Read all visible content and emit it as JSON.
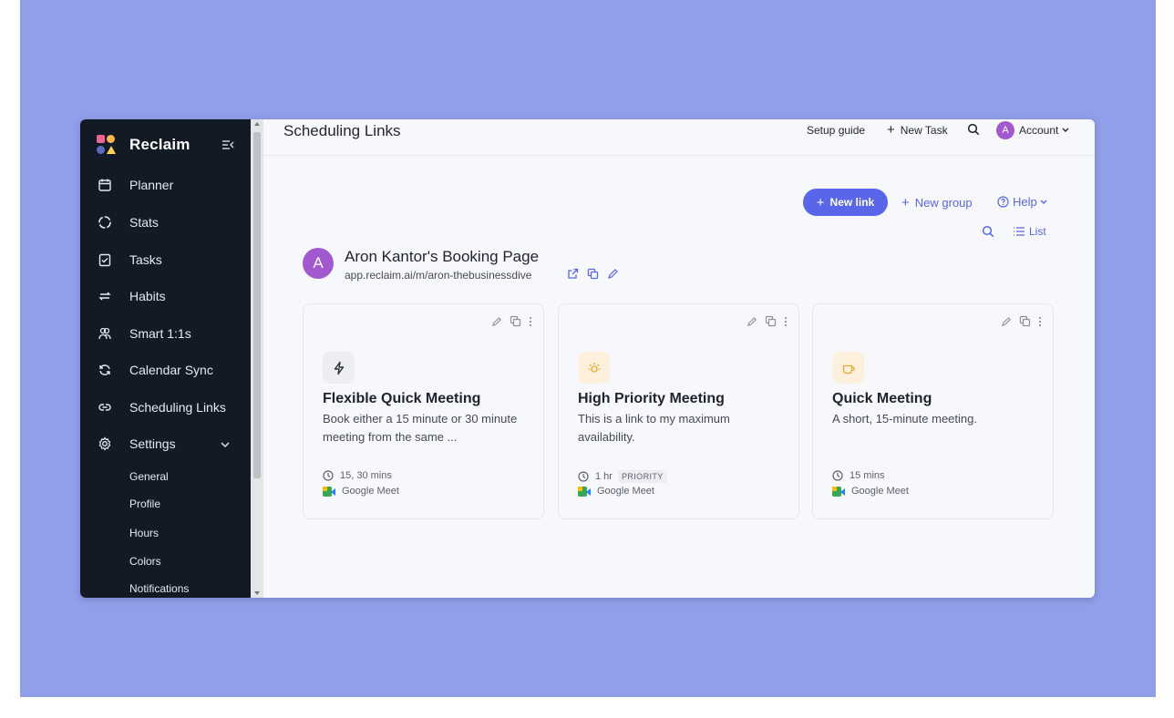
{
  "brand": {
    "name": "Reclaim"
  },
  "sidebar": {
    "items": [
      {
        "label": "Planner",
        "icon": "calendar-icon"
      },
      {
        "label": "Stats",
        "icon": "stats-icon"
      },
      {
        "label": "Tasks",
        "icon": "tasks-icon"
      },
      {
        "label": "Habits",
        "icon": "habits-icon"
      },
      {
        "label": "Smart 1:1s",
        "icon": "people-icon"
      },
      {
        "label": "Calendar Sync",
        "icon": "sync-icon"
      },
      {
        "label": "Scheduling Links",
        "icon": "link-icon"
      },
      {
        "label": "Settings",
        "icon": "gear-icon"
      }
    ],
    "settings_sub": [
      "General",
      "Profile",
      "Hours",
      "Colors",
      "Notifications"
    ]
  },
  "header": {
    "title": "Scheduling Links",
    "setup_guide": "Setup guide",
    "new_task": "New Task",
    "account": "Account",
    "avatar_letter": "A"
  },
  "toolbar": {
    "new_link": "New link",
    "new_group": "New group",
    "help": "Help",
    "list": "List"
  },
  "booking_page": {
    "avatar_letter": "A",
    "title": "Aron Kantor's Booking Page",
    "url": "app.reclaim.ai/m/aron-thebusinessdive"
  },
  "cards": [
    {
      "title": "Flexible Quick Meeting",
      "desc": "Book either a 15 minute or 30 minute meeting from the same ...",
      "duration": "15, 30 mins",
      "badge": "",
      "conference": "Google Meet",
      "icon": "bolt-icon",
      "icon_bg": "#eceef2"
    },
    {
      "title": "High Priority Meeting",
      "desc": "This is a link to my maximum availability.",
      "duration": "1 hr",
      "badge": "PRIORITY",
      "conference": "Google Meet",
      "icon": "sun-icon",
      "icon_bg": "#fdf1dd"
    },
    {
      "title": "Quick Meeting",
      "desc": "A short, 15-minute meeting.",
      "duration": "15 mins",
      "badge": "",
      "conference": "Google Meet",
      "icon": "coffee-icon",
      "icon_bg": "#fdf1dd"
    }
  ],
  "colors": {
    "accent": "#5966ea",
    "sidebar_bg": "#121a26",
    "backdrop": "#919fea",
    "avatar": "#a259d0"
  }
}
